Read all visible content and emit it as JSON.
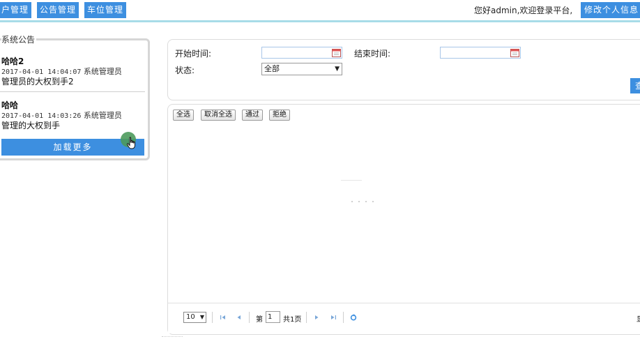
{
  "nav": {
    "user_mgmt": "户管理",
    "notice_mgmt": "公告管理",
    "parking_mgmt": "车位管理",
    "welcome": "您好admin,欢迎登录平台,",
    "edit_profile": "修改个人信息"
  },
  "notices": {
    "legend": "系统公告",
    "items": [
      {
        "title": "哈哈2",
        "time": "2017-04-01 14:04:07",
        "author": "系统管理员",
        "body": "管理员的大权到手2"
      },
      {
        "title": "哈哈",
        "time": "2017-04-01 14:03:26",
        "author": "系统管理员",
        "body": "管理的大权到手"
      }
    ],
    "load_more": "加载更多"
  },
  "search": {
    "start_label": "开始时间:",
    "end_label": "结束时间:",
    "status_label": "状态:",
    "status_value": "全部",
    "query_button": "查"
  },
  "grid": {
    "buttons": {
      "select_all": "全选",
      "deselect_all": "取消全选",
      "approve": "通过",
      "reject": "拒绝"
    },
    "pager": {
      "page_size": "10",
      "page_prefix": "第",
      "current_page": "1",
      "total_pages": "共1页",
      "right_text": "显"
    }
  },
  "colors": {
    "accent": "#3d8fe0",
    "topbar_border": "#a8dce8"
  }
}
